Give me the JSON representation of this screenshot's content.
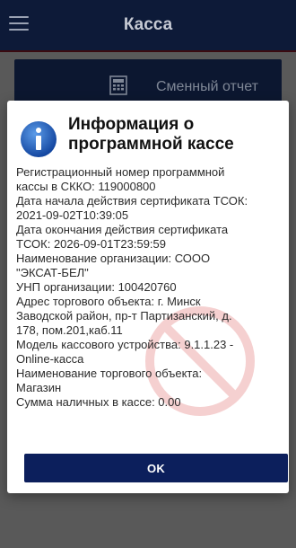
{
  "appbar": {
    "title": "Касса",
    "menu_icon": "hamburger-menu-icon",
    "background": "#0d1a38"
  },
  "background_card": {
    "label": "Сменный отчет",
    "icon": "calculator-icon"
  },
  "dialog": {
    "icon": "info-icon",
    "title_line1": "Информация о",
    "title_line2": "программной кассе",
    "lines": [
      "Регистрационный номер программной",
      "кассы в СККО: 119000800",
      "Дата начала действия сертификата ТСОК:",
      "2021-09-02T10:39:05",
      "Дата окончания действия сертификата",
      "ТСОК: 2026-09-01T23:59:59",
      "Наименование организации: СООО",
      "\"ЭКСАТ-БЕЛ\"",
      "УНП организации: 100420760",
      "Адрес торгового объекта: г. Минск",
      "Заводской район, пр-т Партизанский, д.",
      "178, пом.201,каб.11",
      "Модель кассового устройства: 9.1.1.23 -",
      "Online-касса",
      "Наименование торгового объекта:",
      "Магазин",
      "Сумма наличных в кассе: 0.00"
    ],
    "ok_label": "OK",
    "accent": "#0c1f5c",
    "info_icon_color": "#1e5bb8",
    "watermark_color": "#d32f2f"
  }
}
